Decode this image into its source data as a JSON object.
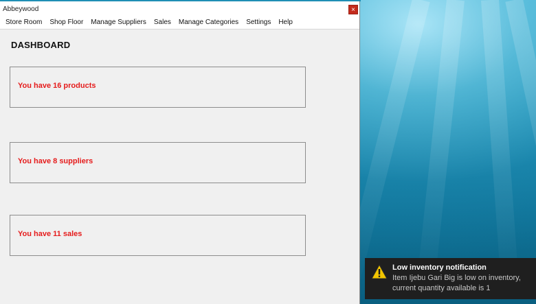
{
  "window": {
    "title": "Abbeywood",
    "close_label": "×"
  },
  "menu": {
    "items": [
      {
        "label": "Store Room"
      },
      {
        "label": "Shop Floor"
      },
      {
        "label": "Manage Suppliers"
      },
      {
        "label": "Sales"
      },
      {
        "label": "Manage Categories"
      },
      {
        "label": "Settings"
      },
      {
        "label": "Help"
      }
    ]
  },
  "dashboard": {
    "title": "DASHBOARD",
    "stats": [
      {
        "text": "You have 16 products"
      },
      {
        "text": "You have 8 suppliers"
      },
      {
        "text": "You have 11 sales"
      }
    ]
  },
  "notification": {
    "title": "Low inventory notification",
    "body": "Item Ijebu Gari Big is low on inventory, current quantity available is 1",
    "icon": "warning-icon"
  },
  "colors": {
    "stat_text": "#e51b1b",
    "close_button": "#c42b1c",
    "toast_background": "#1f1f1f",
    "warning_icon": "#f2c500"
  }
}
